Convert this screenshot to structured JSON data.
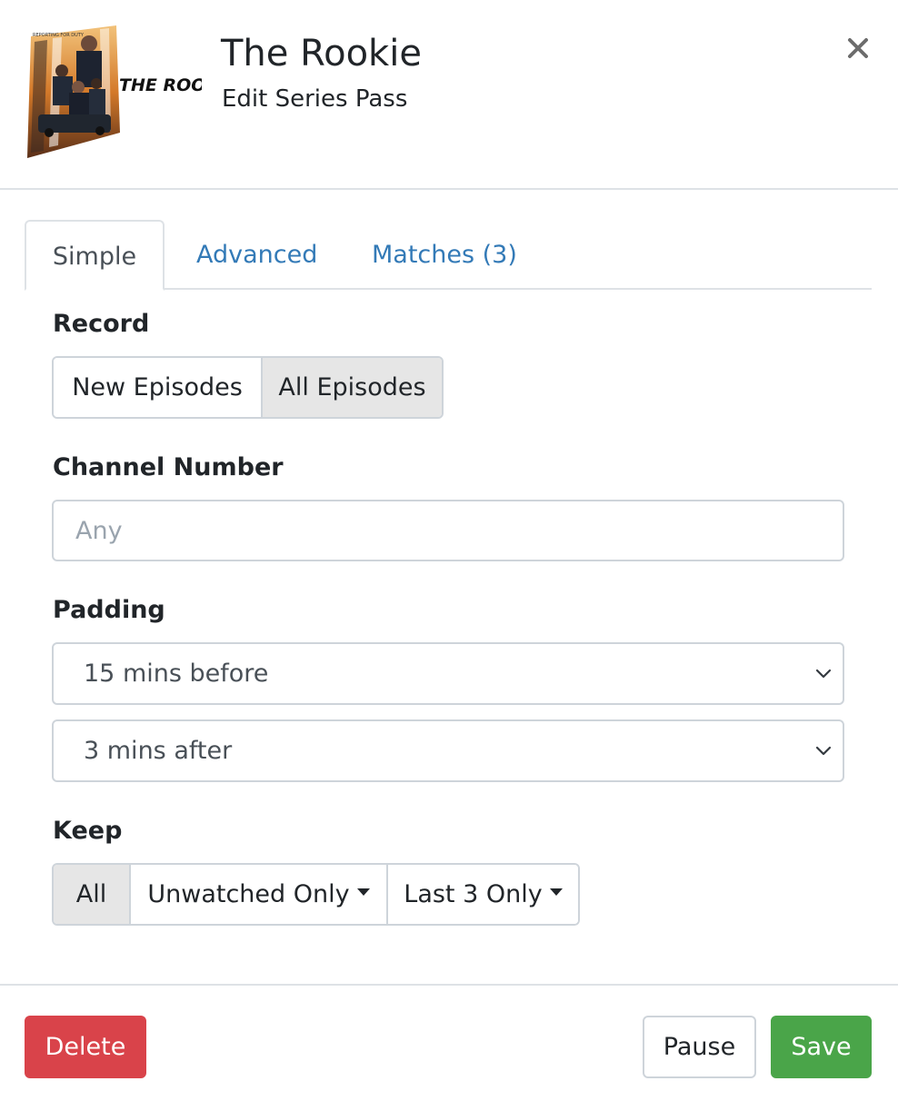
{
  "header": {
    "poster_text": "THE ROOKIE",
    "poster_tagline": "REPORTING FOR DUTY",
    "title": "The Rookie",
    "subtitle": "Edit Series Pass",
    "close_icon": "close-icon"
  },
  "tabs": [
    {
      "label": "Simple",
      "active": true
    },
    {
      "label": "Advanced",
      "active": false
    },
    {
      "label": "Matches (3)",
      "active": false
    }
  ],
  "record": {
    "label": "Record",
    "options": [
      "New Episodes",
      "All Episodes"
    ],
    "selected": "All Episodes"
  },
  "channel": {
    "label": "Channel Number",
    "placeholder": "Any",
    "value": ""
  },
  "padding": {
    "label": "Padding",
    "before": "15 mins before",
    "after": "3 mins after"
  },
  "keep": {
    "label": "Keep",
    "options": [
      "All",
      "Unwatched Only",
      "Last 3 Only"
    ],
    "selected": "All"
  },
  "footer": {
    "delete_label": "Delete",
    "pause_label": "Pause",
    "save_label": "Save"
  },
  "colors": {
    "link": "#337ab7",
    "danger": "#d9434a",
    "success": "#4aa549",
    "selected_segment": "#e6e6e6"
  }
}
